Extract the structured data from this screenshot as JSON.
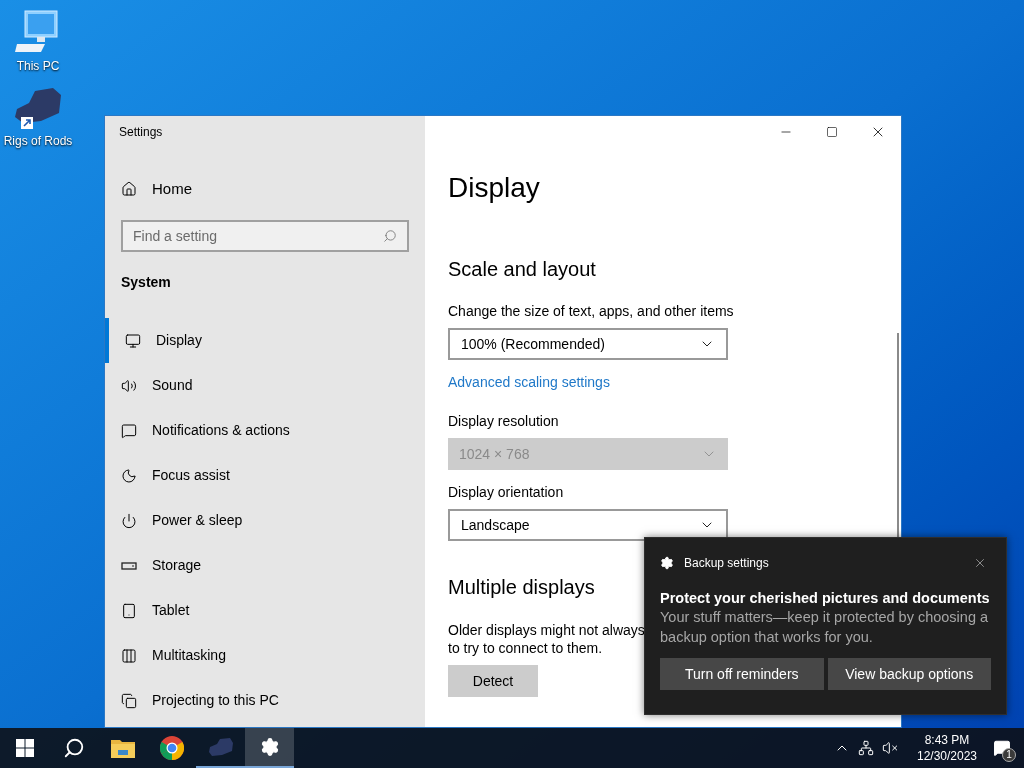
{
  "desktop_icons": [
    {
      "label": "This PC",
      "kind": "computer"
    },
    {
      "label": "Rigs of Rods",
      "kind": "truck-shortcut"
    }
  ],
  "window": {
    "title": "Settings",
    "sidebar": {
      "home": "Home",
      "search": {
        "placeholder": "Find a setting"
      },
      "section": "System",
      "items": [
        {
          "label": "Display",
          "kind": "display",
          "selected": true
        },
        {
          "label": "Sound",
          "kind": "sound",
          "selected": false
        },
        {
          "label": "Notifications & actions",
          "kind": "notifications",
          "selected": false
        },
        {
          "label": "Focus assist",
          "kind": "focus",
          "selected": false
        },
        {
          "label": "Power & sleep",
          "kind": "power",
          "selected": false
        },
        {
          "label": "Storage",
          "kind": "storage",
          "selected": false
        },
        {
          "label": "Tablet",
          "kind": "tablet",
          "selected": false
        },
        {
          "label": "Multitasking",
          "kind": "multitasking",
          "selected": false
        },
        {
          "label": "Projecting to this PC",
          "kind": "projecting",
          "selected": false
        }
      ]
    },
    "content": {
      "title": "Display",
      "scale_and_layout": {
        "heading": "Scale and layout",
        "size_label": "Change the size of text, apps, and other items",
        "size_dropdown": {
          "value": "100% (Recommended)",
          "disabled": false
        },
        "link": "Advanced scaling settings",
        "resolution_label": "Display resolution",
        "resolution_dropdown": {
          "value": "1024 × 768",
          "disabled": true
        },
        "orientation_label": "Display orientation",
        "orientation_dropdown": {
          "value": "Landscape",
          "disabled": false
        }
      },
      "multiple_displays": {
        "heading": "Multiple displays",
        "text_lines": [
          "Older displays might not always",
          "to try to connect to them."
        ],
        "detect_button": "Detect"
      }
    }
  },
  "toast": {
    "app": "Backup settings",
    "title": "Protect your cherished pictures and documents",
    "body": "Your stuff matters—keep it protected by choosing a backup option that works for you.",
    "buttons": [
      "Turn off reminders",
      "View backup options"
    ]
  },
  "taskbar": {
    "apps": [
      {
        "kind": "start",
        "running": false,
        "selected": false
      },
      {
        "kind": "search",
        "running": false,
        "selected": false
      },
      {
        "kind": "explorer",
        "running": false,
        "selected": false
      },
      {
        "kind": "chrome",
        "running": false,
        "selected": false
      },
      {
        "kind": "rigs",
        "running": true,
        "selected": false
      },
      {
        "kind": "settings",
        "running": true,
        "selected": true
      }
    ],
    "time": "8:43 PM",
    "date": "12/30/2023",
    "notification_count": "1",
    "volume_muted": true
  }
}
